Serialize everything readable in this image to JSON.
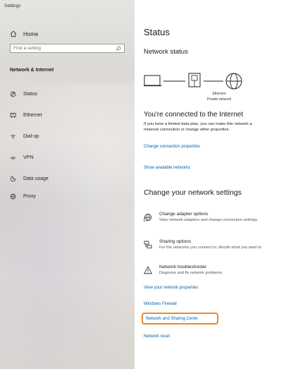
{
  "app": {
    "title": "Settings"
  },
  "sidebar": {
    "home_label": "Home",
    "search_placeholder": "Find a setting",
    "section_title": "Network & Internet",
    "items": [
      {
        "label": "Status",
        "icon": "status-icon"
      },
      {
        "label": "Ethernet",
        "icon": "ethernet-icon"
      },
      {
        "label": "Dial-up",
        "icon": "dialup-icon"
      },
      {
        "label": "VPN",
        "icon": "vpn-icon"
      },
      {
        "label": "Data usage",
        "icon": "data-usage-icon"
      },
      {
        "label": "Proxy",
        "icon": "globe-icon"
      }
    ]
  },
  "main": {
    "title": "Status",
    "network_status_heading": "Network status",
    "diagram": {
      "connection_name": "Ethernet",
      "network_type": "Private network"
    },
    "connected_heading": "You're connected to the Internet",
    "connected_desc_line1": "If you have a limited data plan, you can make this network a",
    "connected_desc_line2": "metered connection or change other properties.",
    "link_change_properties": "Change connection properties",
    "link_show_networks": "Show available networks",
    "change_settings_heading": "Change your network settings",
    "settings": [
      {
        "title": "Change adapter options",
        "desc": "View network adapters and change connection settings.",
        "icon": "adapter-icon"
      },
      {
        "title": "Sharing options",
        "desc": "For the networks you connect to, decide what you want to",
        "icon": "sharing-icon"
      },
      {
        "title": "Network troubleshooter",
        "desc": "Diagnose and fix network problems.",
        "icon": "warning-icon"
      }
    ],
    "links": [
      "View your network properties",
      "Windows Firewall",
      "Network and Sharing Cente",
      "Network reset"
    ]
  },
  "colors": {
    "link": "#0062b1",
    "highlight": "#f08a2a"
  }
}
